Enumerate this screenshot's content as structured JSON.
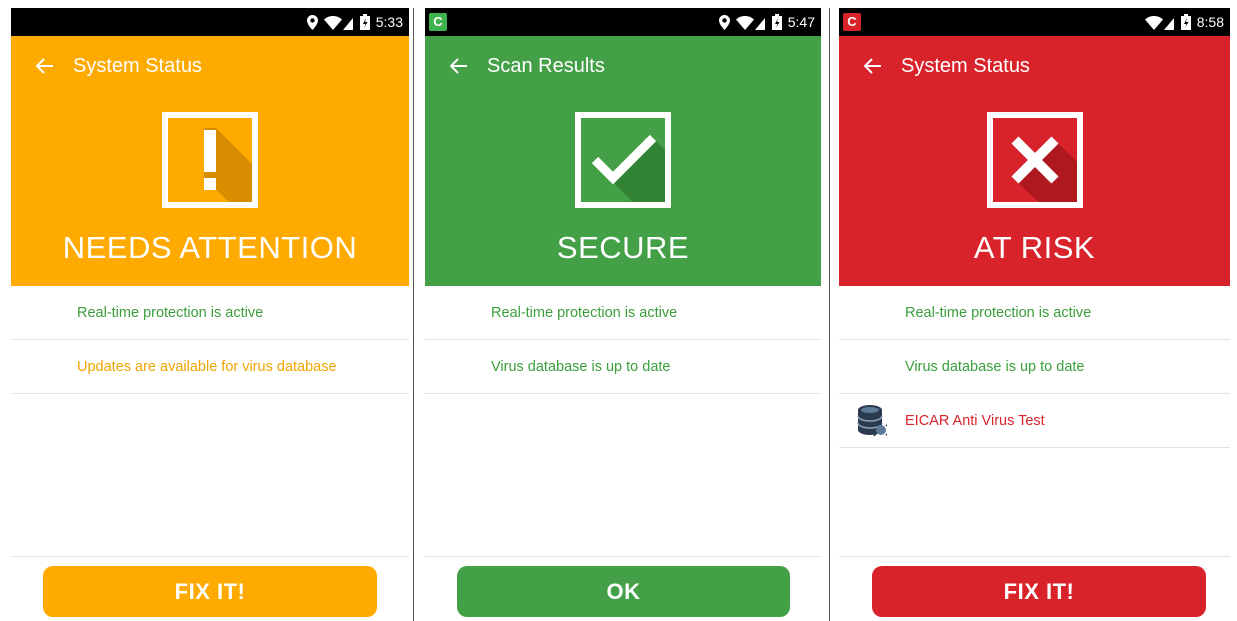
{
  "colors": {
    "attention": "#FFAA00",
    "secure": "#43A047",
    "risk": "#D8232A",
    "green_text": "#3A9E3A",
    "orange_text": "#F0A400",
    "red_text": "#D8232A"
  },
  "screens": [
    {
      "status_time": "5:33",
      "appbar_title": "System Status",
      "status_icon": "exclamation-icon",
      "status_title": "NEEDS ATTENTION",
      "rows": [
        {
          "text": "Real-time protection is active"
        },
        {
          "text": "Updates are available for virus database"
        }
      ],
      "button_label": "FIX IT!"
    },
    {
      "status_time": "5:47",
      "appbar_title": "Scan Results",
      "status_icon": "checkmark-icon",
      "status_title": "SECURE",
      "rows": [
        {
          "text": "Real-time protection is active"
        },
        {
          "text": "Virus database is up to date"
        }
      ],
      "button_label": "OK"
    },
    {
      "status_time": "8:58",
      "appbar_title": "System Status",
      "status_icon": "cross-icon",
      "status_title": "AT RISK",
      "rows": [
        {
          "text": "Real-time protection is active"
        },
        {
          "text": "Virus database is up to date"
        },
        {
          "text": "EICAR Anti Virus Test",
          "icon": "database-threat-icon"
        }
      ],
      "button_label": "FIX IT!"
    }
  ]
}
